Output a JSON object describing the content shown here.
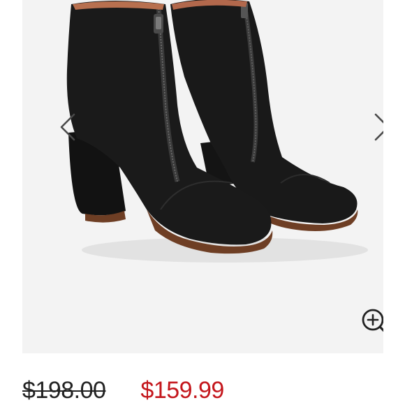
{
  "product": {
    "image_icon": "ankle-boot-photo",
    "original_price": "$198.00",
    "sale_price": "$159.99",
    "sale_color": "#c4161c"
  },
  "gallery": {
    "prev_icon": "chevron-left-icon",
    "next_icon": "chevron-right-icon",
    "zoom_icon": "zoom-in-icon"
  }
}
